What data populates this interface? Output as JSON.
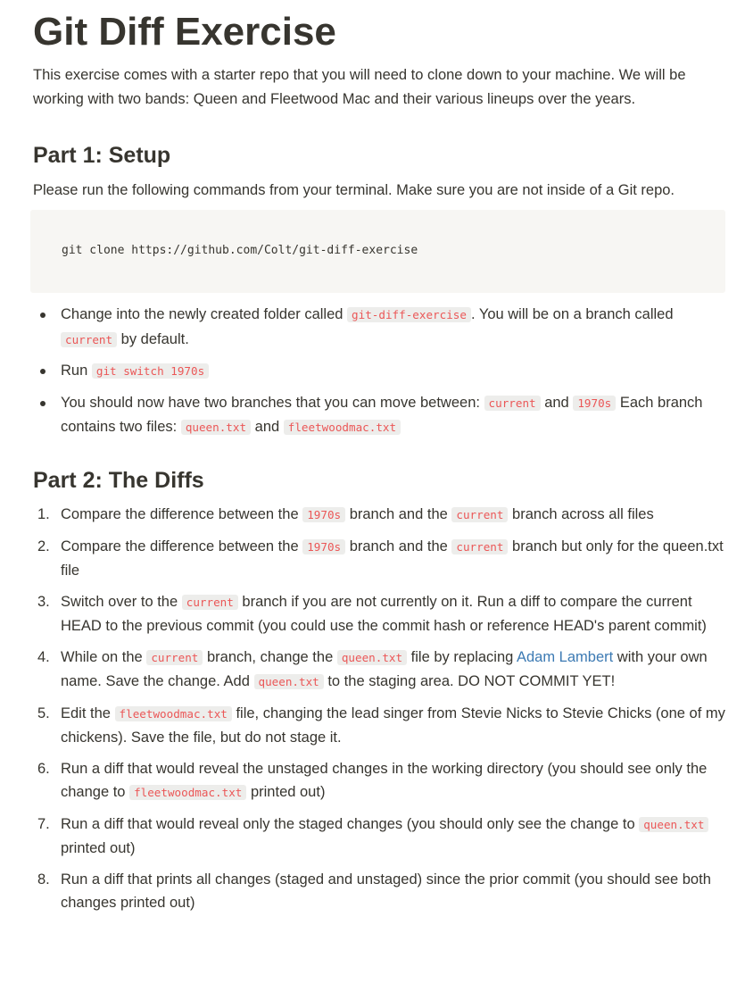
{
  "title": "Git Diff Exercise",
  "intro": "This exercise comes with a starter repo that you will need to clone down to your machine.  We will be working with two bands: Queen and Fleetwood Mac and their various lineups over the years.",
  "part1": {
    "heading": "Part 1: Setup",
    "intro": "Please run the following commands from your terminal.  Make sure you are not inside of a Git repo.",
    "code": "git clone https://github.com/Colt/git-diff-exercise",
    "bullets": [
      {
        "t1": "Change into the newly created folder called ",
        "c1": "git-diff-exercise",
        "t2": ".  You will be on a branch called ",
        "c2": "current",
        "t3": " by default."
      },
      {
        "t1": "Run ",
        "c1": "git switch 1970s"
      },
      {
        "t1": "You should now have two branches that you can move between: ",
        "c1": "current",
        "t2": " and ",
        "c2": "1970s",
        "t3": " Each branch contains two files: ",
        "c3": "queen.txt",
        "t4": " and ",
        "c4": "fleetwoodmac.txt"
      }
    ]
  },
  "part2": {
    "heading": "Part 2: The Diffs",
    "steps": [
      {
        "num": "1.",
        "t1": "Compare the difference between the ",
        "c1": "1970s",
        "t2": " branch and the ",
        "c2": "current",
        "t3": " branch across all files"
      },
      {
        "num": "2.",
        "t1": "Compare the difference between the ",
        "c1": "1970s",
        "t2": " branch and the ",
        "c2": "current",
        "t3": " branch but only for the queen.txt file"
      },
      {
        "num": "3.",
        "t1": "Switch over to the ",
        "c1": "current",
        "t2": " branch if you are not currently on it.   Run a diff to compare the current HEAD to the previous commit (you could use the commit hash or reference HEAD's parent commit)"
      },
      {
        "num": "4.",
        "t1": "While on the ",
        "c1": "current",
        "t2": " branch, change the ",
        "c2": "queen.txt",
        "t3": " file by replacing ",
        "link": "Adam Lambert",
        "t4": " with your own name.  Save the change.  Add ",
        "c3": "queen.txt",
        "t5": " to the staging area.  DO NOT COMMIT YET!"
      },
      {
        "num": "5.",
        "t1": "Edit the ",
        "c1": "fleetwoodmac.txt",
        "t2": " file, changing the lead singer from Stevie Nicks to Stevie Chicks (one of my chickens).  Save the file, but do not stage it."
      },
      {
        "num": "6.",
        "t1": "Run a diff that would reveal the unstaged changes in the working directory (you should see only the change to ",
        "c1": "fleetwoodmac.txt",
        "t2": " printed out)"
      },
      {
        "num": "7.",
        "t1": "Run a diff that would reveal only the staged changes (you should only see the change to ",
        "c1": "queen.txt",
        "t2": " printed out)"
      },
      {
        "num": "8.",
        "t1": "Run a diff that prints all changes (staged and unstaged) since the prior commit (you should see both changes printed out)"
      }
    ]
  }
}
